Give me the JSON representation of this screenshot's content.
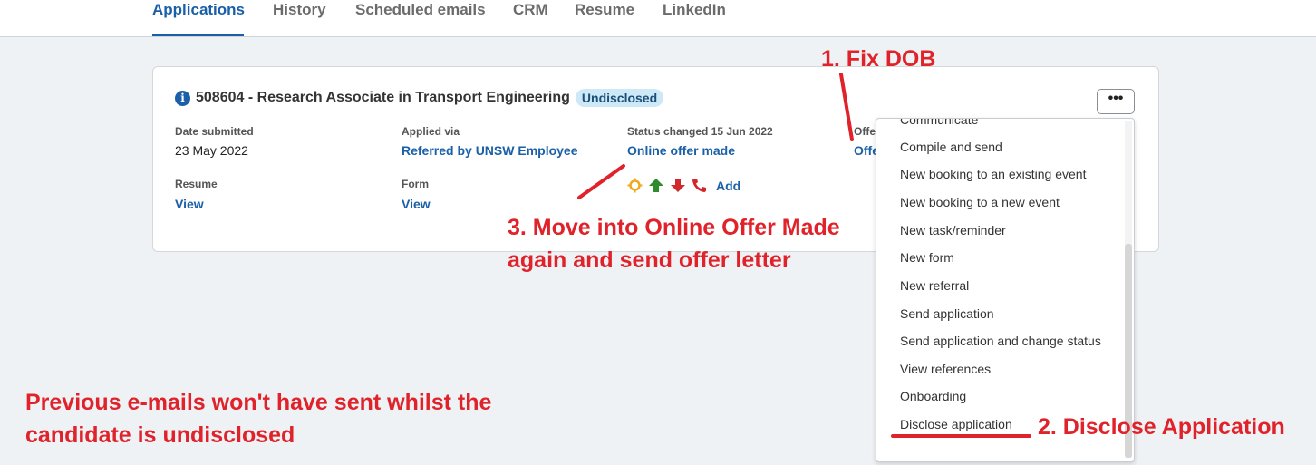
{
  "tabs": [
    {
      "label": "Applications",
      "active": true
    },
    {
      "label": "History"
    },
    {
      "label": "Scheduled emails"
    },
    {
      "label": "CRM"
    },
    {
      "label": "Resume"
    },
    {
      "label": "LinkedIn"
    }
  ],
  "application": {
    "title": "508604 - Research Associate in Transport Engineering",
    "badge": "Undisclosed",
    "date_submitted_label": "Date submitted",
    "date_submitted": "23 May 2022",
    "applied_via_label": "Applied via",
    "applied_via": "Referred by UNSW Employee",
    "status_label": "Status changed 15 Jun 2022",
    "status": "Online offer made",
    "offer_label": "Offe",
    "offer_value": "Offe",
    "resume_label": "Resume",
    "resume_link": "View",
    "form_label": "Form",
    "form_link": "View",
    "add_label": "Add",
    "more_label": "•••"
  },
  "menu": {
    "items": [
      "Communicate",
      "Compile and send",
      "New booking to an existing event",
      "New booking to a new event",
      "New task/reminder",
      "New form",
      "New referral",
      "Send application",
      "Send application and change status",
      "View references",
      "Onboarding",
      "Disclose application"
    ]
  },
  "annotations": {
    "fix_dob": "1. Fix DOB",
    "disclose": "2. Disclose Application",
    "move_line1": "3. Move into Online Offer Made",
    "move_line2": "again and send offer letter",
    "note_line1": "Previous e-mails won't have sent whilst the",
    "note_line2": "candidate is undisclosed"
  },
  "colors": {
    "accent": "#1a5fa8",
    "annotation": "#e0232a",
    "badge_bg": "#cde8f6"
  }
}
